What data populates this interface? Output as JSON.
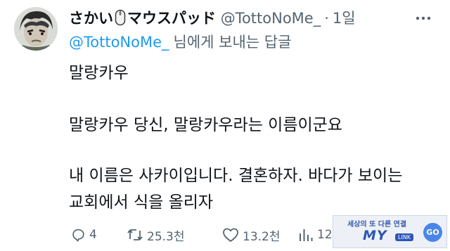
{
  "author": {
    "display_name": "さかい",
    "display_name_suffix": "マウスパッド",
    "handle": "@TottoNoMe_",
    "separator": "·",
    "time": "1일"
  },
  "reply": {
    "handle": "@TottoNoMe_",
    "suffix": "님에게 보내는 답글"
  },
  "body": {
    "line1": "말랑카우",
    "line2": "말랑카우 당신, 말랑카우라는 이름이군요",
    "line3": "내 이름은 사카이입니다. 결혼하자. 바다가 보이는",
    "line4": "교회에서 식을 올리자"
  },
  "actions": {
    "reply_count": "4",
    "retweet_count": "25.3천",
    "like_count": "13.2천",
    "views_count": "12"
  },
  "watermark": {
    "tagline": "세상의 또 다른 연결",
    "logo": "MY",
    "logo_badge": "LINK",
    "go": "GO"
  },
  "colors": {
    "link": "#1d9bf0",
    "secondary_text": "#536471",
    "primary_text": "#0f1419"
  },
  "icons": [
    "mouse-emoji-icon",
    "more-icon",
    "reply-icon",
    "retweet-icon",
    "like-icon",
    "views-icon"
  ]
}
